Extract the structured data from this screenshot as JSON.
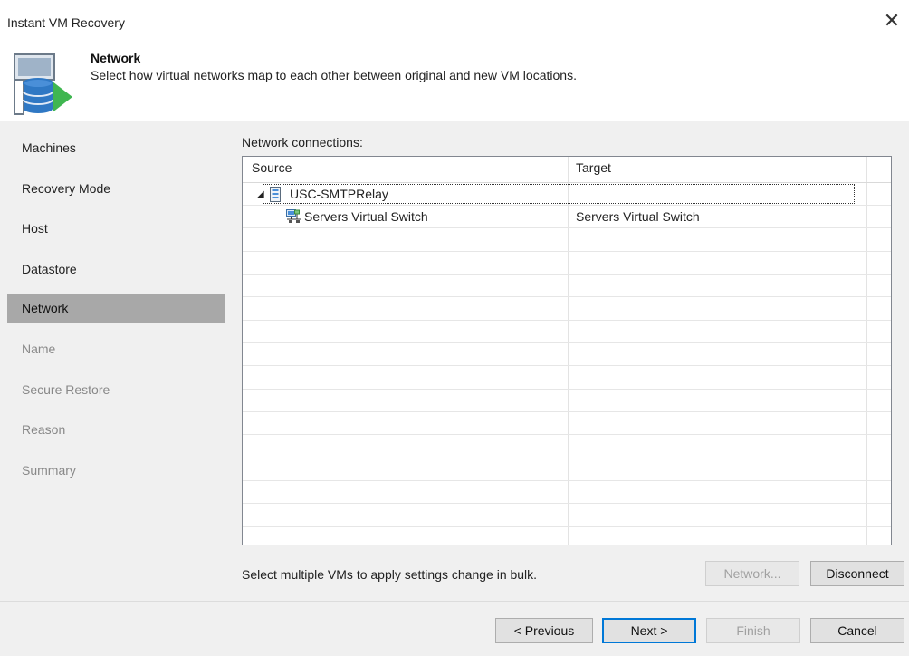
{
  "window": {
    "title": "Instant VM Recovery",
    "close_glyph": "✕"
  },
  "header": {
    "title": "Network",
    "subtitle": "Select how virtual networks map to each other between original and new VM locations."
  },
  "sidebar": {
    "items": [
      {
        "label": "Machines",
        "state": "enabled"
      },
      {
        "label": "Recovery Mode",
        "state": "enabled"
      },
      {
        "label": "Host",
        "state": "enabled"
      },
      {
        "label": "Datastore",
        "state": "enabled"
      },
      {
        "label": "Network",
        "state": "active"
      },
      {
        "label": "Name",
        "state": "disabled"
      },
      {
        "label": "Secure Restore",
        "state": "disabled"
      },
      {
        "label": "Reason",
        "state": "disabled"
      },
      {
        "label": "Summary",
        "state": "disabled"
      }
    ]
  },
  "main": {
    "connections_label": "Network connections:",
    "table": {
      "columns": [
        "Source",
        "Target"
      ],
      "vm": {
        "expander": "◢",
        "name": "USC-SMTPRelay",
        "icon": "vm-icon"
      },
      "rows": [
        {
          "source": "Servers Virtual Switch",
          "target": "Servers Virtual Switch",
          "icon": "network-icon"
        }
      ]
    },
    "bulk_hint": "Select multiple VMs to apply settings change in bulk.",
    "network_button": "Network...",
    "disconnect_button": "Disconnect"
  },
  "footer": {
    "previous": "< Previous",
    "next": "Next >",
    "finish": "Finish",
    "cancel": "Cancel"
  },
  "colors": {
    "accent": "#0078d7",
    "header_icon_green": "#3fb650",
    "header_icon_blue": "#2f78c4",
    "active_nav": "#a8a8a8"
  }
}
